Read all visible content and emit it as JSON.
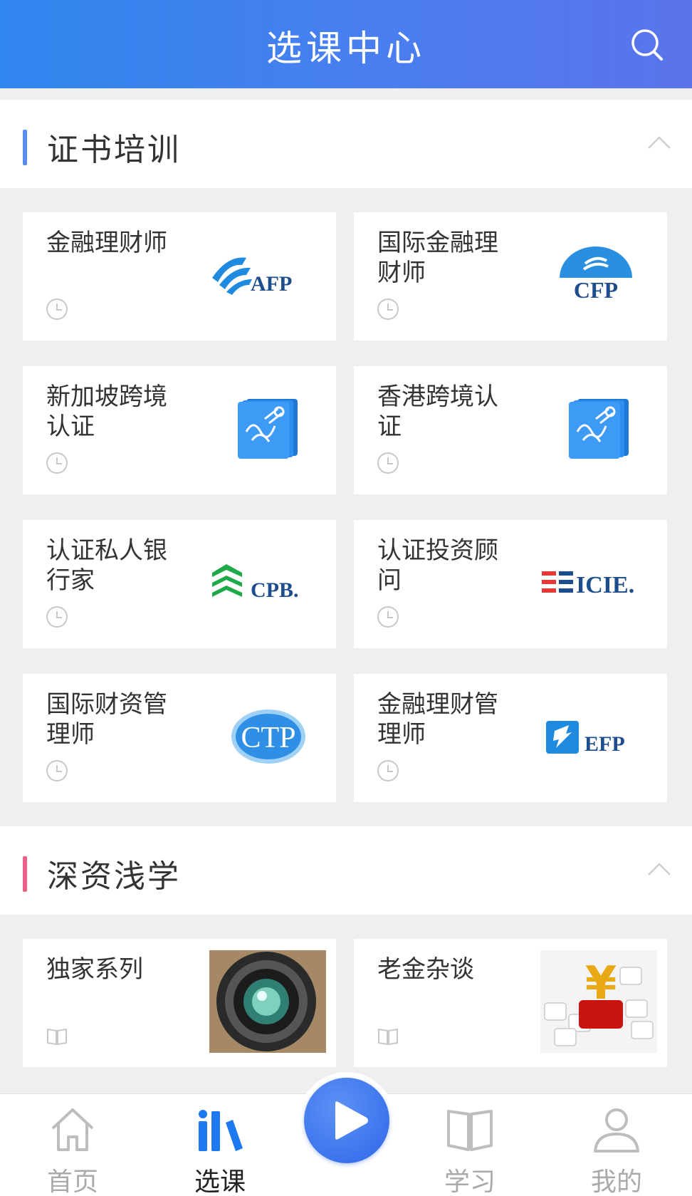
{
  "header": {
    "title": "选课中心",
    "search_icon": "search-icon"
  },
  "sections": [
    {
      "title": "证书培训",
      "accent": "#5b8def",
      "cards": [
        {
          "name": "金融理财师",
          "logo_text": "AFP"
        },
        {
          "name": "国际金融理财师",
          "logo_text": "CFP"
        },
        {
          "name": "新加坡跨境认证",
          "logo_text": ""
        },
        {
          "name": "香港跨境认证",
          "logo_text": ""
        },
        {
          "name": "认证私人银行家",
          "logo_text": "CPB."
        },
        {
          "name": "认证投资顾问",
          "logo_text": "ICIE."
        },
        {
          "name": "国际财资管理师",
          "logo_text": "CTP"
        },
        {
          "name": "金融理财管理师",
          "logo_text": "EFP"
        }
      ]
    },
    {
      "title": "深资浅学",
      "accent": "#ec5f86",
      "cards": [
        {
          "name": "独家系列"
        },
        {
          "name": "老金杂谈"
        }
      ]
    }
  ],
  "nav": {
    "items": [
      {
        "label": "首页",
        "icon": "home-icon"
      },
      {
        "label": "选课",
        "icon": "course-icon",
        "active": true
      },
      {
        "label": "学习",
        "icon": "study-book-icon"
      },
      {
        "label": "我的",
        "icon": "profile-icon"
      }
    ],
    "center_icon": "play-icon"
  },
  "colors": {
    "header_start": "#2f86ee",
    "header_end": "#5b74ea",
    "active_nav": "#1e78f0"
  }
}
